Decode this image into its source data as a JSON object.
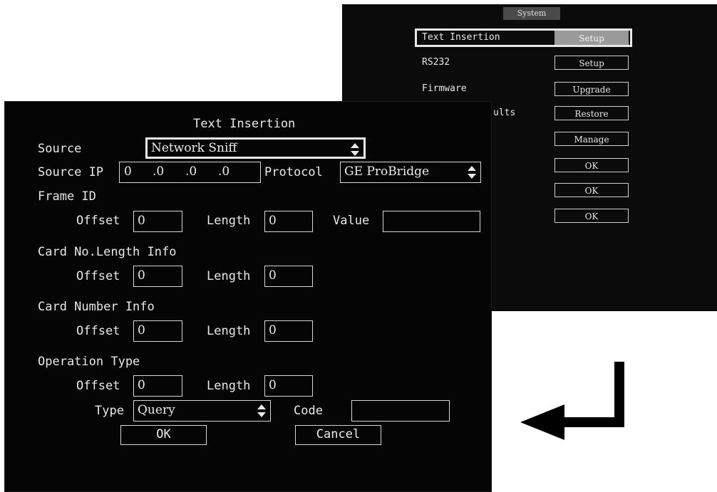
{
  "system_menu": {
    "title": "System",
    "rows": [
      {
        "label": "Text Insertion",
        "button": "Setup"
      },
      {
        "label": "RS232",
        "button": "Setup"
      },
      {
        "label": "Firmware",
        "button": "Upgrade"
      },
      {
        "label": "ults",
        "button": "Restore"
      },
      {
        "label": "",
        "button": "Manage"
      },
      {
        "label": "",
        "button": "OK"
      },
      {
        "label": "",
        "button": "OK"
      },
      {
        "label": "",
        "button": "OK"
      }
    ]
  },
  "text_insertion": {
    "title": "Text Insertion",
    "source": {
      "label": "Source",
      "value": "Network Sniff"
    },
    "source_ip": {
      "label": "Source IP",
      "octets": [
        "0",
        ".0",
        ".0",
        ".0"
      ]
    },
    "protocol": {
      "label": "Protocol",
      "value": "GE ProBridge"
    },
    "frame_id": {
      "heading": "Frame ID",
      "offset_label": "Offset",
      "offset_value": "0",
      "length_label": "Length",
      "length_value": "0",
      "value_label": "Value",
      "value_value": ""
    },
    "card_no_length": {
      "heading": "Card No.Length Info",
      "offset_label": "Offset",
      "offset_value": "0",
      "length_label": "Length",
      "length_value": "0"
    },
    "card_number": {
      "heading": "Card Number Info",
      "offset_label": "Offset",
      "offset_value": "0",
      "length_label": "Length",
      "length_value": "0"
    },
    "operation_type": {
      "heading": "Operation Type",
      "offset_label": "Offset",
      "offset_value": "0",
      "length_label": "Length",
      "length_value": "0",
      "type_label": "Type",
      "type_value": "Query",
      "code_label": "Code",
      "code_value": ""
    },
    "ok_label": "OK",
    "cancel_label": "Cancel"
  },
  "icons": {
    "flow_arrow": "return-arrow-icon",
    "select_arrows": "updown-arrows-icon"
  },
  "colors": {
    "background": "#050505",
    "text": "#e8e8e8",
    "highlight": "#9a9a9a"
  }
}
